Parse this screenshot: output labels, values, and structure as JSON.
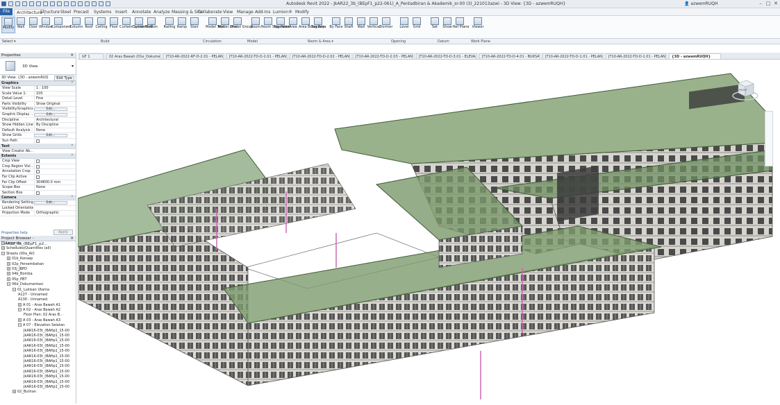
{
  "titlebar": {
    "title": "Autodesk Revit 2022 - JkAR22_3b_(BEpF1_p22-061)_A_Pentadbiran & Akademik_sr-00 (3)_221013azwi - 3D View: {3D - azwemRUQH}",
    "user": "azwemRUQH"
  },
  "ribbon_tabs": [
    "File",
    "Architecture",
    "Structure",
    "Steel",
    "Precast",
    "Systems",
    "Insert",
    "Annotate",
    "Analyze",
    "Massing & Site",
    "Collaborate",
    "View",
    "Manage",
    "Add-Ins",
    "Lumion®",
    "Modify"
  ],
  "ribbon_buttons": [
    {
      "label": "Modify"
    },
    {
      "label": "Wall"
    },
    {
      "label": "Door"
    },
    {
      "label": "Window"
    },
    {
      "label": "Component"
    },
    {
      "label": "Column"
    },
    {
      "label": "Roof"
    },
    {
      "label": "Ceiling"
    },
    {
      "label": "Floor"
    },
    {
      "label": "Curtain System"
    },
    {
      "label": "Curtain Grid"
    },
    {
      "label": "Mullion"
    },
    {
      "label": "Railing"
    },
    {
      "label": "Ramp"
    },
    {
      "label": "Stair"
    },
    {
      "label": "Model Text"
    },
    {
      "label": "Model Line"
    },
    {
      "label": "Model Group"
    },
    {
      "label": "Room"
    },
    {
      "label": "Room Separator"
    },
    {
      "label": "Tag Room"
    },
    {
      "label": "Area"
    },
    {
      "label": "Area Boundary"
    },
    {
      "label": "Tag Area"
    },
    {
      "label": "By Face"
    },
    {
      "label": "Shaft"
    },
    {
      "label": "Wall"
    },
    {
      "label": "Vertical"
    },
    {
      "label": "Dormer"
    },
    {
      "label": "Level"
    },
    {
      "label": "Grid"
    },
    {
      "label": "Set"
    },
    {
      "label": "Show"
    },
    {
      "label": "Ref Plane"
    },
    {
      "label": "Viewer"
    }
  ],
  "ribbon_panels": {
    "select": "Select ▾",
    "build": "Build",
    "circulation": "Circulation",
    "model": "Model",
    "room_area": "Room & Area ▾",
    "opening": "Opening",
    "datum": "Datum",
    "work_plane": "Work Plane"
  },
  "properties": {
    "header": "Properties",
    "type_name": "3D View",
    "instance": "3D View: {3D - azwemRUQ",
    "edit_type": "Edit Type",
    "sections": [
      {
        "title": "Graphics",
        "rows": [
          {
            "k": "View Scale",
            "v": "1 : 100"
          },
          {
            "k": "Scale Value    1:",
            "v": "100"
          },
          {
            "k": "Detail Level",
            "v": "Fine"
          },
          {
            "k": "Parts Visibility",
            "v": "Show Original"
          },
          {
            "k": "Visibility/Graphics...",
            "btn": "Edit..."
          },
          {
            "k": "Graphic Display ...",
            "btn": "Edit..."
          },
          {
            "k": "Discipline",
            "v": "Architectural"
          },
          {
            "k": "Show Hidden Lines",
            "v": "By Discipline"
          },
          {
            "k": "Default Analysis ...",
            "v": "None"
          },
          {
            "k": "Show Grids",
            "btn": "Edit..."
          },
          {
            "k": "Sun Path",
            "cb": true
          }
        ]
      },
      {
        "title": "Text",
        "rows": [
          {
            "k": "View Creator Ab...",
            "v": ""
          }
        ]
      },
      {
        "title": "Extents",
        "rows": [
          {
            "k": "Crop View",
            "cb": true
          },
          {
            "k": "Crop Region Visi...",
            "cb": true
          },
          {
            "k": "Annotation Crop",
            "cb": true
          },
          {
            "k": "Far Clip Active",
            "cb": true
          },
          {
            "k": "Far Clip Offset",
            "v": "304800.0 mm"
          },
          {
            "k": "Scope Box",
            "v": "None"
          },
          {
            "k": "Section Box",
            "cb": true
          }
        ]
      },
      {
        "title": "Camera",
        "rows": [
          {
            "k": "Rendering Settings",
            "btn": "Edit..."
          },
          {
            "k": "Locked Orientation",
            "v": ""
          },
          {
            "k": "Projection Mode",
            "v": "Orthographic"
          }
        ]
      }
    ],
    "help_link": "Properties help",
    "apply": "Apply"
  },
  "browser": {
    "header": "Project Browser - JkAR22_3b_(BEpF1_p2...",
    "items": [
      {
        "t": "Legends",
        "d": 0,
        "ex": "+"
      },
      {
        "t": "Schedules/Quantities (all)",
        "d": 0,
        "ex": "+"
      },
      {
        "t": "Sheets (00a_All)",
        "d": 0,
        "ex": "−"
      },
      {
        "t": "01b_Konsep",
        "d": 1,
        "ex": "+"
      },
      {
        "t": "02p_Persembahan",
        "d": 1,
        "ex": "+"
      },
      {
        "t": "03j_JBPD",
        "d": 1,
        "ex": "+"
      },
      {
        "t": "04b_Bomba",
        "d": 1,
        "ex": "+"
      },
      {
        "t": "05p_PBT",
        "d": 1,
        "ex": "+"
      },
      {
        "t": "06d_Dokumentasi",
        "d": 1,
        "ex": "−"
      },
      {
        "t": "01_Lukisan Utama",
        "d": 2,
        "ex": "−"
      },
      {
        "t": "A127 - Unnamed",
        "d": 3,
        "ex": ""
      },
      {
        "t": "A130 - Unnamed",
        "d": 3,
        "ex": ""
      },
      {
        "t": "A 01 - Aras Bawah A1",
        "d": 3,
        "ex": "+"
      },
      {
        "t": "A 02 - Aras Bawah A2",
        "d": 3,
        "ex": "−"
      },
      {
        "t": "Floor Plan: 02 Aras B...",
        "d": 4,
        "ex": ""
      },
      {
        "t": "A 03 - Aras Bawah A3",
        "d": 3,
        "ex": "+"
      },
      {
        "t": "A 07 - Elevation Selatan",
        "d": 3,
        "ex": "−"
      },
      {
        "t": "JkAR16-03t_(BAftp1_15-00",
        "d": 4,
        "ex": ""
      },
      {
        "t": "JkAR16-03t_(BAftp1_15-00",
        "d": 4,
        "ex": ""
      },
      {
        "t": "JkAR16-03t_(BAftp1_15-00",
        "d": 4,
        "ex": ""
      },
      {
        "t": "JkAR16-03t_(BAftp1_15-00",
        "d": 4,
        "ex": ""
      },
      {
        "t": "JkAR16-03t_(BAftp1_15-00",
        "d": 4,
        "ex": ""
      },
      {
        "t": "JkAR16-03t_(BAftp1_15-00",
        "d": 4,
        "ex": ""
      },
      {
        "t": "JkAR16-03t_(BAftp1_15-00",
        "d": 4,
        "ex": ""
      },
      {
        "t": "JkAR16-03t_(BAftp1_15-00",
        "d": 4,
        "ex": ""
      },
      {
        "t": "JkAR16-03t_(BAftp1_15-00",
        "d": 4,
        "ex": ""
      },
      {
        "t": "JkAR16-03t_(BAftp1_15-00",
        "d": 4,
        "ex": ""
      },
      {
        "t": "JkAR16-03t_(BAftp1_15-00",
        "d": 4,
        "ex": ""
      },
      {
        "t": "JkAR16-03t_(BAftp1_15-00",
        "d": 4,
        "ex": ""
      },
      {
        "t": "02_Butiran",
        "d": 2,
        "ex": "+"
      }
    ]
  },
  "view_tabs": [
    {
      "label": "GF 1"
    },
    {
      "label": "02 Aras Bawah (01e_Dokumen)"
    },
    {
      "label": "JT10-AR-2022-RF-D-2.01 - PELAN..."
    },
    {
      "label": "JT10-AR-2022-TD-D-2.01 - PELAN..."
    },
    {
      "label": "JT10-AR-2022-TD-D-2.02 - PELAN..."
    },
    {
      "label": "JT10-AR-2022-TD-D-2.03 - PELAN..."
    },
    {
      "label": "JT10-AR-2022-TD-D-3.01 - ELEVA..."
    },
    {
      "label": "JT10-AR-2022-TD-D-4.01 - BUKSA..."
    },
    {
      "label": "JT10-AR-2022-TD-D-1.01 - PELAN..."
    },
    {
      "label": "JT10-AR-2022-TD-D-1.01 - PELAN..."
    },
    {
      "label": "{3D - azwemRUQH}",
      "active": true
    }
  ],
  "viewcube_label": "FRONT"
}
